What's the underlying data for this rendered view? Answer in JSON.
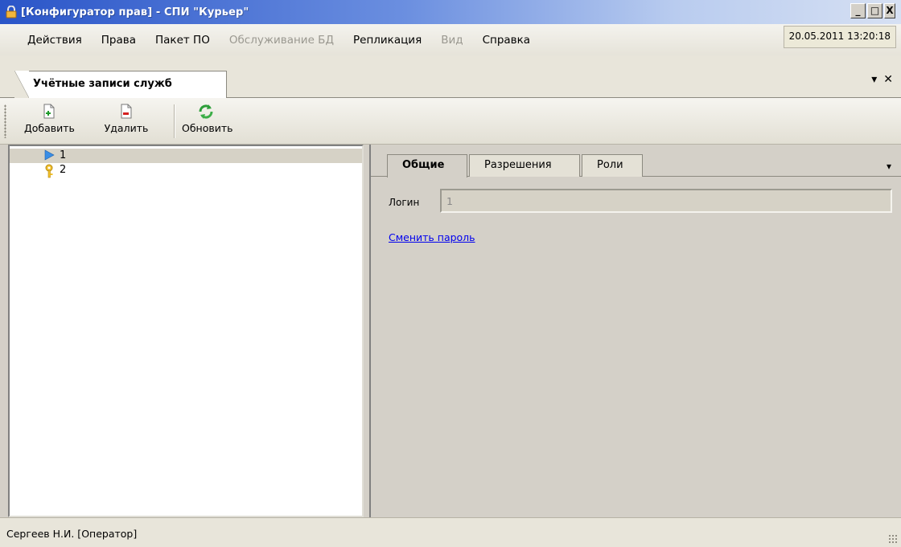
{
  "window": {
    "title": "[Конфигуратор прав] - СПИ \"Курьер\"",
    "icon": "lock-icon",
    "controls": {
      "minimize": "_",
      "restore": "□",
      "close": "X"
    }
  },
  "menu": {
    "items": [
      {
        "label": "Действия",
        "disabled": false
      },
      {
        "label": "Права",
        "disabled": false
      },
      {
        "label": "Пакет ПО",
        "disabled": false
      },
      {
        "label": "Обслуживание БД",
        "disabled": true
      },
      {
        "label": "Репликация",
        "disabled": false
      },
      {
        "label": "Вид",
        "disabled": true
      },
      {
        "label": "Справка",
        "disabled": false
      }
    ],
    "datetime": "20.05.2011 13:20:18"
  },
  "document_tab": {
    "label": "Учётные записи служб",
    "controls": {
      "dropdown": "▾",
      "close": "✕"
    }
  },
  "toolbar": {
    "add_label": "Добавить",
    "delete_label": "Удалить",
    "refresh_label": "Обновить"
  },
  "tree": {
    "items": [
      {
        "label": "1",
        "icon": "play-arrow-icon",
        "selected": true
      },
      {
        "label": "2",
        "icon": "key-icon",
        "selected": false
      }
    ]
  },
  "details": {
    "tabs": [
      {
        "label": "Общие",
        "active": true
      },
      {
        "label": "Разрешения",
        "active": false
      },
      {
        "label": "Роли",
        "active": false
      }
    ],
    "tab_menu": "▾",
    "login_label": "Логин",
    "login_value": "1",
    "change_password_link": "Сменить пароль"
  },
  "status": {
    "user": "Сергеев Н.И. [Оператор]"
  },
  "colors": {
    "titlebar_start": "#2a55c8",
    "link": "#0000ee",
    "panel": "#d4d0c8"
  }
}
